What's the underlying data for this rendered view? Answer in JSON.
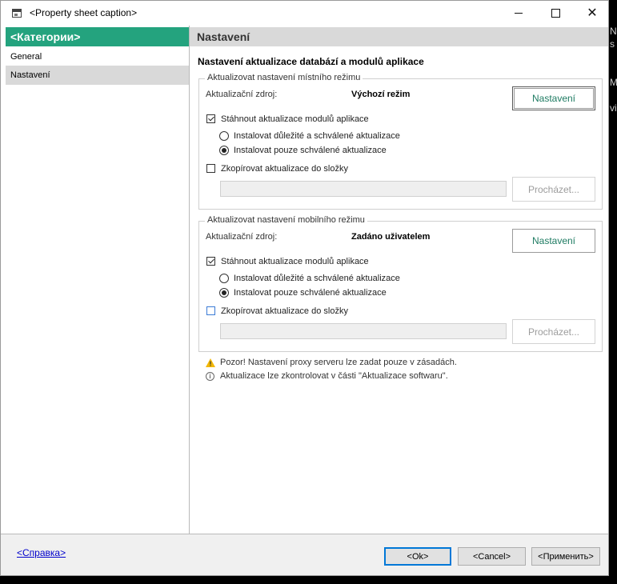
{
  "window": {
    "title": "<Property sheet caption>"
  },
  "sidebar": {
    "header": "<Категории>",
    "items": [
      {
        "label": "General",
        "selected": false
      },
      {
        "label": "Nastavení",
        "selected": true
      }
    ]
  },
  "content": {
    "header": "Nastavení",
    "section_title": "Nastavení aktualizace databází a modulů aplikace",
    "local": {
      "legend": "Aktualizovat nastavení místního režimu",
      "source_label": "Aktualizační zdroj:",
      "source_value": "Výchozí režim",
      "settings_button": "Nastavení",
      "download_label": "Stáhnout aktualizace modulů aplikace",
      "download_checked": true,
      "radio_important": "Instalovat důležité a schválené aktualizace",
      "radio_approved": "Instalovat pouze schválené aktualizace",
      "selected_radio": "approved",
      "copy_label": "Zkopírovat aktualizace do složky",
      "copy_checked": false,
      "folder_value": "",
      "browse_button": "Procházet..."
    },
    "mobile": {
      "legend": "Aktualizovat nastavení mobilního režimu",
      "source_label": "Aktualizační zdroj:",
      "source_value": "Zadáno uživatelem",
      "settings_button": "Nastavení",
      "download_label": "Stáhnout aktualizace modulů aplikace",
      "download_checked": true,
      "radio_important": "Instalovat důležité a schválené aktualizace",
      "radio_approved": "Instalovat pouze schválené aktualizace",
      "selected_radio": "approved",
      "copy_label": "Zkopírovat aktualizace do složky",
      "copy_checked": false,
      "folder_value": "",
      "browse_button": "Procházet..."
    },
    "warning_text": "Pozor! Nastavení proxy serveru lze zadat pouze v zásadách.",
    "info_text": "Aktualizace lze zkontrolovat v části \"Aktualizace softwaru\"."
  },
  "footer": {
    "help_link": "<Справка>",
    "ok_button": "<Ok>",
    "cancel_button": "<Cancel>",
    "apply_button": "<Применить>"
  },
  "background_fragments": [
    "N",
    "s",
    "Ma",
    "vi"
  ],
  "colors": {
    "accent": "#24a37e",
    "link": "#0000cc",
    "button_text": "#1e7b62"
  }
}
